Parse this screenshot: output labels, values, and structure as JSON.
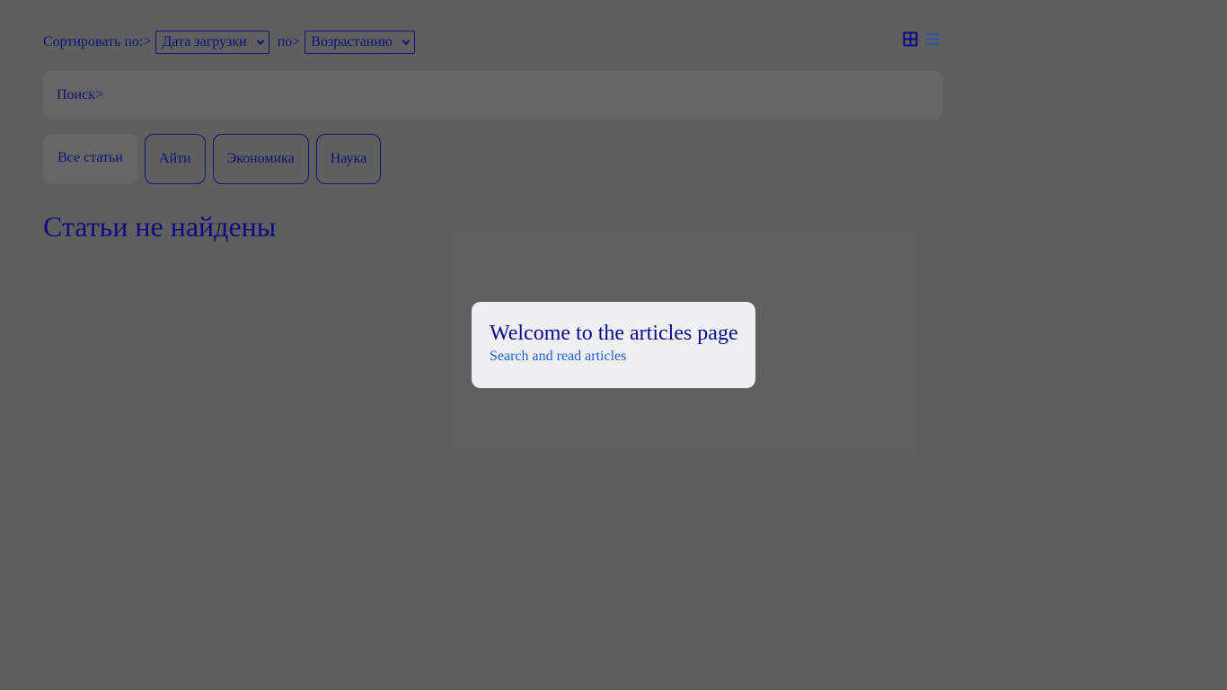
{
  "sort": {
    "label": "Сортировать по:>",
    "field_value": "Дата загрузки",
    "order_label": "по>",
    "order_value": "Возрастанию"
  },
  "view_toggles": {
    "grid_icon": "grid-view-icon",
    "list_icon": "list-view-icon",
    "active": "grid"
  },
  "search": {
    "label": "Поиск>"
  },
  "tabs": [
    {
      "label": "Все статьи",
      "active": true
    },
    {
      "label": "Айти",
      "active": false
    },
    {
      "label": "Экономика",
      "active": false
    },
    {
      "label": "Наука",
      "active": false
    }
  ],
  "main": {
    "empty_message": "Статьи не найдены"
  },
  "modal": {
    "title": "Welcome to the articles page",
    "subtitle": "Search and read articles"
  },
  "colors": {
    "text": "#10107a",
    "overlay": "#5f5f5f",
    "modal_bg": "#efeff4",
    "link": "#1f5fd6"
  }
}
